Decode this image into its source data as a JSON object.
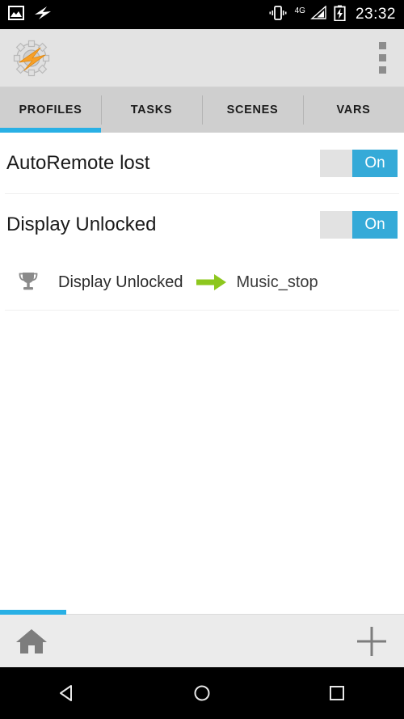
{
  "status_bar": {
    "left_icons": [
      "image-icon",
      "tasker-bolt-icon"
    ],
    "right_icons": [
      "vibrate-icon",
      "signal-4g-icon",
      "battery-charging-icon"
    ],
    "network_label": "4G",
    "time": "23:32"
  },
  "app_bar": {
    "logo": "tasker-logo-icon",
    "overflow": "overflow-menu-icon"
  },
  "tabs": [
    {
      "label": "PROFILES",
      "active": true
    },
    {
      "label": "TASKS",
      "active": false
    },
    {
      "label": "SCENES",
      "active": false
    },
    {
      "label": "VARS",
      "active": false
    }
  ],
  "profiles": [
    {
      "name": "AutoRemote lost",
      "toggle_label": "On",
      "enabled": true
    },
    {
      "name": "Display Unlocked",
      "toggle_label": "On",
      "enabled": true
    }
  ],
  "expanded_detail": {
    "context_icon": "trophy-icon",
    "context_label": "Display Unlocked",
    "link_icon": "green-arrow-icon",
    "task_label": "Music_stop"
  },
  "bottom_bar": {
    "home": "home-icon",
    "add": "plus-icon"
  },
  "nav_bar": {
    "back": "back-triangle-icon",
    "home": "home-circle-icon",
    "recents": "recents-square-icon"
  },
  "colors": {
    "accent_blue": "#29b0e5",
    "toggle_blue": "#35aad8",
    "arrow_green": "#8dc71e",
    "tab_bar_gray": "#cfcfcf",
    "app_bar_gray": "#e3e3e3",
    "bottom_bar_gray": "#ebebeb",
    "logo_orange": "#f7a028"
  }
}
